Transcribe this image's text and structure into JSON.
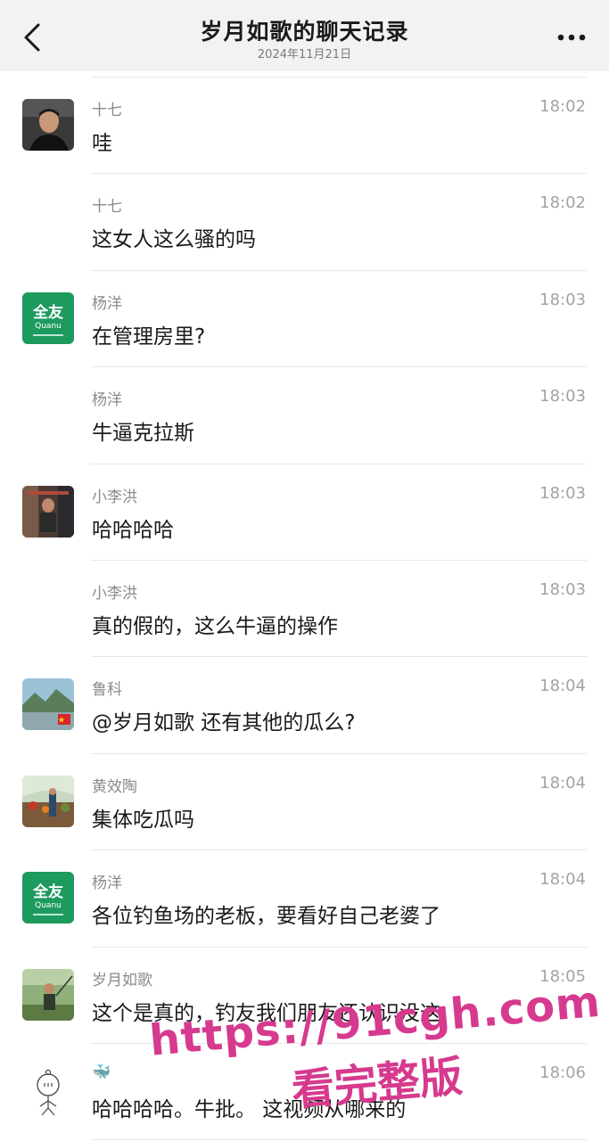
{
  "header": {
    "title": "岁月如歌的聊天记录",
    "date": "2024年11月21日",
    "back_icon": "chevron-left-icon",
    "more_icon": "more-dots-icon"
  },
  "messages": [
    {
      "sender": "十七",
      "time": "18:02",
      "text": "哇",
      "avatar": "photo-man"
    },
    {
      "sender": "十七",
      "time": "18:02",
      "text": "这女人这么骚的吗",
      "avatar": ""
    },
    {
      "sender": "杨洋",
      "time": "18:03",
      "text": "在管理房里?",
      "avatar": "quanyou-logo"
    },
    {
      "sender": "杨洋",
      "time": "18:03",
      "text": "牛逼克拉斯",
      "avatar": ""
    },
    {
      "sender": "小李洪",
      "time": "18:03",
      "text": "哈哈哈哈",
      "avatar": "photo-gym"
    },
    {
      "sender": "小李洪",
      "time": "18:03",
      "text": "真的假的，这么牛逼的操作",
      "avatar": ""
    },
    {
      "sender": "鲁科",
      "time": "18:04",
      "text": "@岁月如歌 还有其他的瓜么?",
      "avatar": "photo-lake"
    },
    {
      "sender": "黄效陶",
      "time": "18:04",
      "text": "集体吃瓜吗",
      "avatar": "photo-garden"
    },
    {
      "sender": "杨洋",
      "time": "18:04",
      "text": "各位钓鱼场的老板，要看好自己老婆了",
      "avatar": "quanyou-logo"
    },
    {
      "sender": "岁月如歌",
      "time": "18:05",
      "text": "这个是真的，钓友我们朋友还认识没这",
      "avatar": "photo-fishing"
    },
    {
      "sender": "🐳",
      "time": "18:06",
      "text": "哈哈哈哈。牛批。 这视频从哪来的",
      "avatar": "sketch-doodle"
    }
  ],
  "logo": {
    "line1": "全友",
    "line2": "Quanu",
    "color": "#1d9a5e"
  },
  "watermark": {
    "line1": "https://91cgh.com",
    "line2": "看完整版"
  }
}
